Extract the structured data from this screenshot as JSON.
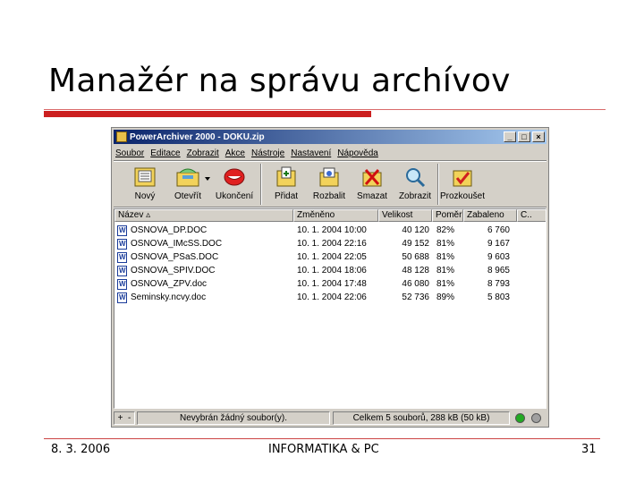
{
  "slide": {
    "title": "Manažér na správu archívov",
    "footer_date": "8. 3. 2006",
    "footer_center": "INFORMATIKA & PC",
    "page_number": "31"
  },
  "window": {
    "title": "PowerArchiver 2000 - DOKU.zip",
    "buttons": [
      "_",
      "□",
      "×"
    ]
  },
  "menu": [
    "Soubor",
    "Editace",
    "Zobrazit",
    "Akce",
    "Nástroje",
    "Nastavení",
    "Nápověda"
  ],
  "toolbar": [
    {
      "label": "Nový",
      "icon": "new-archive-icon"
    },
    {
      "label": "Otevřít",
      "icon": "open-archive-icon"
    },
    {
      "label": "Ukončení",
      "icon": "exit-icon"
    },
    {
      "label": "Přidat",
      "icon": "add-files-icon"
    },
    {
      "label": "Rozbalit",
      "icon": "extract-icon"
    },
    {
      "label": "Smazat",
      "icon": "delete-icon"
    },
    {
      "label": "Zobrazit",
      "icon": "view-icon"
    },
    {
      "label": "Prozkoušet",
      "icon": "test-icon"
    }
  ],
  "columns": [
    "Název",
    "Změněno",
    "Velikost",
    "Poměr",
    "Zabaleno",
    "C.."
  ],
  "files": [
    {
      "name": "OSNOVA_DP.DOC",
      "modified": "10. 1. 2004 10:00",
      "size": "40 120",
      "ratio": "82%",
      "packed": "6 760"
    },
    {
      "name": "OSNOVA_IMcSS.DOC",
      "modified": "10. 1. 2004 22:16",
      "size": "49 152",
      "ratio": "81%",
      "packed": "9 167"
    },
    {
      "name": "OSNOVA_PSaS.DOC",
      "modified": "10. 1. 2004 22:05",
      "size": "50 688",
      "ratio": "81%",
      "packed": "9 603"
    },
    {
      "name": "OSNOVA_SPIV.DOC",
      "modified": "10. 1. 2004 18:06",
      "size": "48 128",
      "ratio": "81%",
      "packed": "8 965"
    },
    {
      "name": "OSNOVA_ZPV.doc",
      "modified": "10. 1. 2004 17:48",
      "size": "46 080",
      "ratio": "81%",
      "packed": "8 793"
    },
    {
      "name": "Seminsky.ncvy.doc",
      "modified": "10. 1. 2004 22:06",
      "size": "52 736",
      "ratio": "89%",
      "packed": "5 803"
    }
  ],
  "status": {
    "selected": "Nevybrán žádný soubor(y).",
    "total": "Celkem 5 souborů, 288 kB (50 kB)",
    "indicator_colors": [
      "#22aa22",
      "#a0a0a0"
    ]
  }
}
